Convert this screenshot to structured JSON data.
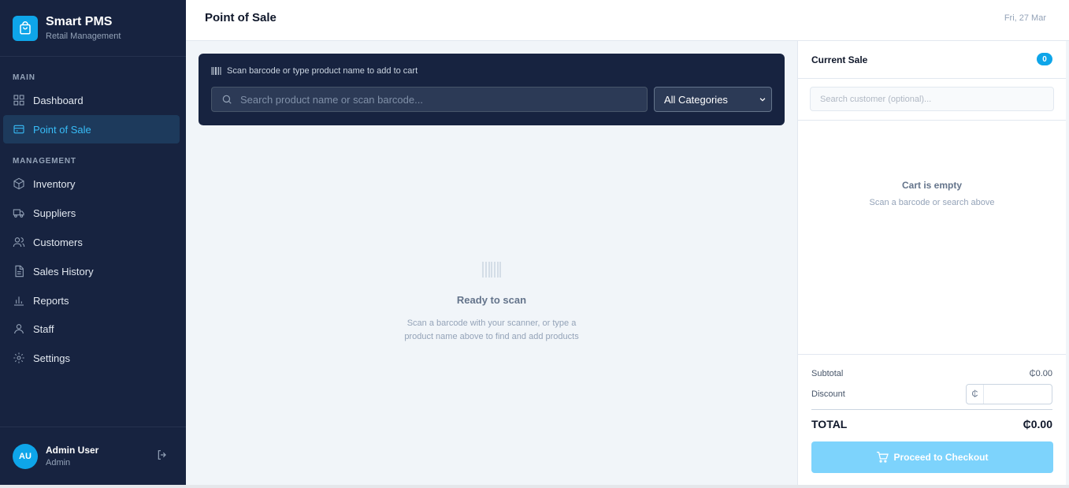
{
  "brand": {
    "name": "Smart PMS",
    "subtitle": "Retail Management"
  },
  "nav": {
    "main_label": "MAIN",
    "management_label": "MANAGEMENT",
    "items": [
      {
        "label": "Dashboard",
        "icon": "grid-icon",
        "active": false
      },
      {
        "label": "Point of Sale",
        "icon": "pos-icon",
        "active": true
      },
      {
        "label": "Inventory",
        "icon": "box-icon",
        "active": false
      },
      {
        "label": "Suppliers",
        "icon": "truck-icon",
        "active": false
      },
      {
        "label": "Customers",
        "icon": "users-icon",
        "active": false
      },
      {
        "label": "Sales History",
        "icon": "file-icon",
        "active": false
      },
      {
        "label": "Reports",
        "icon": "bar-chart-icon",
        "active": false
      },
      {
        "label": "Staff",
        "icon": "user-icon",
        "active": false
      },
      {
        "label": "Settings",
        "icon": "gear-icon",
        "active": false
      }
    ]
  },
  "user": {
    "initials": "AU",
    "name": "Admin User",
    "role": "Admin"
  },
  "header": {
    "title": "Point of Sale",
    "date": "Fri, 27 Mar"
  },
  "scan": {
    "hint": "Scan barcode or type product name to add to cart",
    "search_placeholder": "Search product name or scan barcode...",
    "category": "All Categories"
  },
  "empty_state": {
    "title": "Ready to scan",
    "line1": "Scan a barcode with your scanner, or type a",
    "line2": "product name above to find and add products"
  },
  "cart": {
    "title": "Current Sale",
    "count": "0",
    "customer_placeholder": "Search customer (optional)...",
    "empty_title": "Cart is empty",
    "empty_sub": "Scan a barcode or search above",
    "subtotal_label": "Subtotal",
    "subtotal_value": "₵0.00",
    "discount_label": "Discount",
    "currency_symbol": "₵",
    "total_label": "TOTAL",
    "total_value": "₵0.00",
    "checkout_label": "Proceed to Checkout"
  },
  "colors": {
    "sidebar": "#172340",
    "accent": "#0ea5e9",
    "checkout_disabled": "#7dd3fc"
  }
}
